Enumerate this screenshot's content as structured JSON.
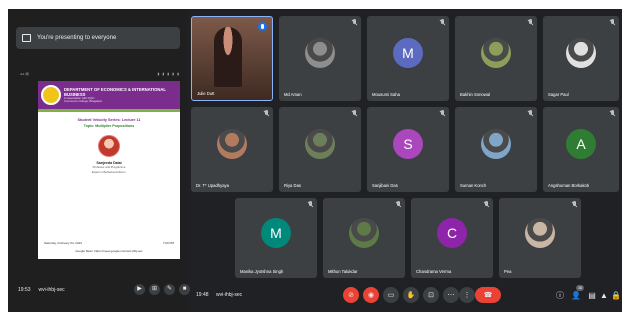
{
  "presenting": {
    "banner_text": "You're presenting to everyone",
    "slide_toolbar_left": "◂ ▸ ▤",
    "slide_toolbar_dots": "▮ ▮ ▮ ▮ ▮",
    "slide": {
      "department": "DEPARTMENT OF ECONOMICS & INTERNATIONAL BUSINESS",
      "subtitle": "In association with IQAC",
      "college": "Commerce College, Bhagalpur",
      "lecture_title": "Student Velocity Series: Lecture 11",
      "topic": "Topic: Multiplier Propositions",
      "speaker_name": "Sanjeeda Dalai",
      "speaker_desc": "Professor and Programme",
      "speaker_desc2": "Expert in Behavioural Econ.",
      "date": "Saturday, February 04, 2023",
      "time": "7:00 PM",
      "link": "Google Meet: https://meet.google.com/wvi-ihbj-sec"
    },
    "left_time": "19:53",
    "left_code": "wvi-ihbj-sec"
  },
  "participants": [
    {
      "name": "Julie Dutt",
      "kind": "video",
      "speaking": true
    },
    {
      "name": "Md Aman",
      "kind": "photo",
      "color": "#8e8e8e"
    },
    {
      "name": "Mousumi Saha",
      "kind": "letter",
      "letter": "M",
      "color": "#5c6bc0"
    },
    {
      "name": "Bakhin Sonowal",
      "kind": "photo",
      "color": "#8d9e5a"
    },
    {
      "name": "Sagar Paul",
      "kind": "photo",
      "color": "#e0e0e0"
    },
    {
      "name": "Dr. T* Upadhyaya",
      "kind": "photo",
      "color": "#b07b5e"
    },
    {
      "name": "Riya Das",
      "kind": "photo",
      "color": "#6d7f5a"
    },
    {
      "name": "Sanjibani Das",
      "kind": "letter",
      "letter": "S",
      "color": "#ab47bc"
    },
    {
      "name": "Suman Konch",
      "kind": "photo",
      "color": "#7fa6c9"
    },
    {
      "name": "Angshuman Borkakoti",
      "kind": "letter",
      "letter": "A",
      "color": "#2e7d32"
    },
    {
      "name": "Manika Jyotshna Singh",
      "kind": "letter",
      "letter": "M",
      "color": "#00897b"
    },
    {
      "name": "Mithun Talukdar",
      "kind": "photo",
      "color": "#5d7a47"
    },
    {
      "name": "Chandrama Verma",
      "kind": "letter",
      "letter": "C",
      "color": "#8e24aa"
    },
    {
      "name": "Pea",
      "kind": "photo",
      "color": "#c9b6a4"
    }
  ],
  "bottombar": {
    "time": "19:48",
    "code": "wvi-ihbj-sec",
    "mic_icon": "mic-off-icon",
    "cam_icon": "camera-off-icon",
    "people_count": "16"
  },
  "left_ctrl_glyphs": [
    "▶",
    "⊞",
    "✎",
    "■"
  ],
  "ctrl_glyphs": {
    "mic": "⊘",
    "cam": "◉",
    "cc": "▭",
    "hand": "✋",
    "present": "⊡",
    "more_opts": "⋯",
    "more": "⋮",
    "leave": "☎",
    "info": "ⓘ",
    "people": "👤",
    "chat": "▤",
    "activities": "▲",
    "lock": "🔒"
  }
}
